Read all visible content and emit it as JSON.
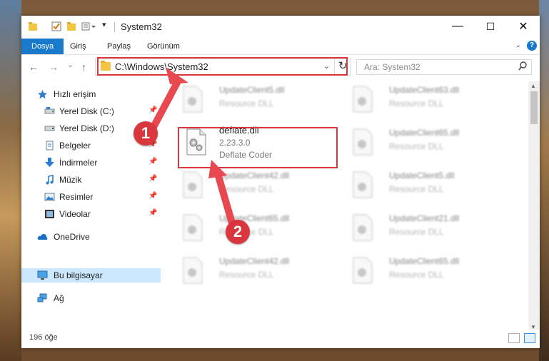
{
  "window": {
    "title": "System32"
  },
  "title_buttons": {
    "minimize": "—",
    "maximize": "☐",
    "close": "✕"
  },
  "ribbon": {
    "tabs": [
      "Dosya",
      "Giriş",
      "Paylaş",
      "Görünüm"
    ],
    "help": "?"
  },
  "navigation": {
    "back": "←",
    "forward": "→",
    "recent": "⌄",
    "up": "↑",
    "address": "C:\\Windows\\System32",
    "search_placeholder": "Ara: System32"
  },
  "sidebar": {
    "items": [
      {
        "label": "Hızlı erişim",
        "icon": "star-icon"
      },
      {
        "label": "Yerel Disk (C:)",
        "icon": "drive-icon",
        "pinned": true
      },
      {
        "label": "Yerel Disk (D:)",
        "icon": "drive-icon",
        "pinned": true
      },
      {
        "label": "Belgeler",
        "icon": "documents-icon",
        "pinned": true
      },
      {
        "label": "İndirmeler",
        "icon": "download-icon",
        "pinned": true
      },
      {
        "label": "Müzik",
        "icon": "music-icon",
        "pinned": true
      },
      {
        "label": "Resimler",
        "icon": "pictures-icon",
        "pinned": true
      },
      {
        "label": "Videolar",
        "icon": "videos-icon",
        "pinned": true
      },
      {
        "label": "OneDrive",
        "icon": "cloud-icon"
      },
      {
        "label": "Bu bilgisayar",
        "icon": "computer-icon",
        "selected": true
      },
      {
        "label": "Ağ",
        "icon": "network-icon"
      }
    ]
  },
  "files": {
    "highlighted": {
      "name": "deflate.dll",
      "version": "2.23.3.0",
      "description": "Deflate Coder"
    },
    "blurred": [
      {
        "name": "UpdateClient5.dll",
        "description": "Resource DLL"
      },
      {
        "name": "UpdateClient63.dll",
        "description": "Resource DLL"
      },
      {
        "name": "UpdateClient65.dll",
        "description": "Resource DLL"
      },
      {
        "name": "UpdateClient42.dll",
        "description": "Resource DLL"
      },
      {
        "name": "UpdateClient5.dll",
        "description": "Resource DLL"
      },
      {
        "name": "UpdateClient65.dll",
        "description": "Resource DLL"
      },
      {
        "name": "UpdateClient21.dll",
        "description": "Resource DLL"
      },
      {
        "name": "UpdateClient42.dll",
        "description": "Resource DLL"
      },
      {
        "name": "UpdateClient65.dll",
        "description": "Resource DLL"
      }
    ]
  },
  "status": {
    "item_count": "196 öğe"
  },
  "callouts": [
    "1",
    "2"
  ],
  "colors": {
    "accent": "#1979ca",
    "highlight": "#d9363e",
    "selection": "#cce8ff"
  }
}
